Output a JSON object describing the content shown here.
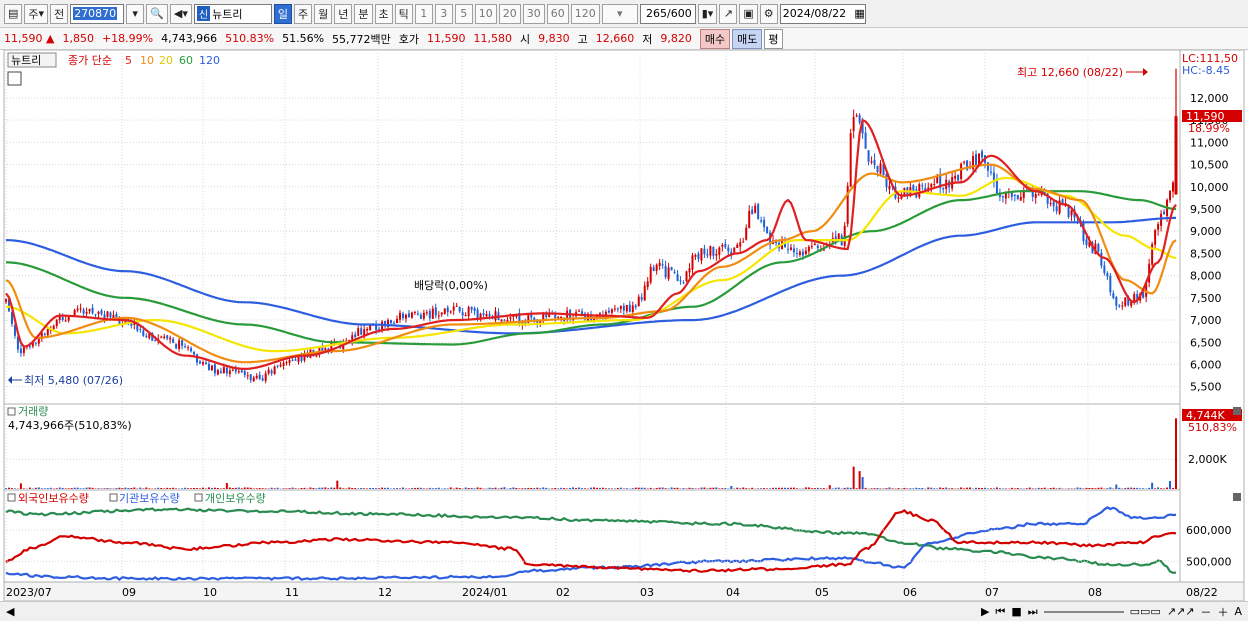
{
  "toolbar": {
    "period_type": "주",
    "prev_label": "전",
    "stock_code": "270870",
    "badge": "신",
    "stock_name": "뉴트리",
    "periods": [
      "일",
      "주",
      "월",
      "년",
      "분",
      "초",
      "틱"
    ],
    "active_period": "일",
    "intervals": [
      "1",
      "3",
      "5",
      "10",
      "20",
      "30",
      "60",
      "120"
    ],
    "count": "265",
    "count_max": "/600",
    "date": "2024/08/22"
  },
  "quote": {
    "price": "11,590",
    "change": "1,850",
    "change_pct": "+18.99%",
    "volume": "4,743,966",
    "volume_ratio": "510.83%",
    "turnover_pct": "51.56%",
    "amount": "55,772백만",
    "bid_label": "호가",
    "ask": "11,590",
    "bid": "11,580",
    "open_label": "시",
    "open": "9,830",
    "high_label": "고",
    "high": "12,660",
    "low_label": "저",
    "low": "9,820",
    "buy_label": "매수",
    "sell_label": "매도",
    "eval_label": "평"
  },
  "colors": {
    "up": "#d40000",
    "down": "#1c5fd6",
    "ma5": "#e02020",
    "ma10": "#f08c10",
    "ma20": "#f5e600",
    "ma60": "#2a9b3a",
    "ma120": "#2e5ee0",
    "foreign": "#d40000",
    "institution": "#2e5ee0",
    "individual": "#2a8b50",
    "grid": "#d8d8d8"
  },
  "chart_data": [
    {
      "type": "candlestick",
      "legend_title": "뉴트리",
      "legend": [
        "종가 단순",
        "5",
        "10",
        "20",
        "60",
        "120"
      ],
      "ylim": [
        5200,
        12900
      ],
      "y_ticks": [
        "12,000",
        "11,500",
        "11,000",
        "10,500",
        "10,000",
        "9,500",
        "9,000",
        "8,500",
        "8,000",
        "7,500",
        "7,000",
        "6,500",
        "6,000",
        "5,500"
      ],
      "y_tick_values": [
        12000,
        11500,
        11000,
        10500,
        10000,
        9500,
        9000,
        8500,
        8000,
        7500,
        7000,
        6500,
        6000,
        5500
      ],
      "x_ticks": [
        "2023/07",
        "09",
        "10",
        "11",
        "12",
        "2024/01",
        "02",
        "03",
        "04",
        "05",
        "06",
        "07",
        "08",
        "08/22"
      ],
      "right_top": "LC:111,50",
      "right_hc": "HC:-8.45",
      "current_price": "11,590",
      "current_pct": "18.99%",
      "annotation_high": "최고 12,660 (08/22)",
      "annotation_low": "최저 5,480 (07/26)",
      "annotation_div": "배당락(0,00%)",
      "ma_keypoints": {
        "ma5": [
          [
            0,
            7600
          ],
          [
            6,
            6400
          ],
          [
            18,
            7100
          ],
          [
            40,
            7000
          ],
          [
            60,
            6200
          ],
          [
            80,
            5900
          ],
          [
            100,
            6200
          ],
          [
            130,
            6800
          ],
          [
            150,
            7000
          ],
          [
            180,
            7150
          ],
          [
            200,
            7100
          ],
          [
            215,
            7050
          ],
          [
            225,
            7600
          ],
          [
            232,
            8100
          ],
          [
            245,
            8500
          ],
          [
            255,
            8800
          ],
          [
            262,
            9700
          ],
          [
            268,
            8800
          ],
          [
            282,
            8600
          ],
          [
            287,
            11500
          ],
          [
            300,
            9800
          ],
          [
            320,
            10100
          ],
          [
            330,
            10700
          ],
          [
            345,
            9900
          ],
          [
            355,
            9600
          ],
          [
            368,
            8400
          ],
          [
            378,
            7400
          ],
          [
            386,
            8300
          ],
          [
            392,
            9600
          ]
        ],
        "ma10": [
          [
            0,
            7900
          ],
          [
            10,
            6600
          ],
          [
            40,
            7050
          ],
          [
            80,
            6050
          ],
          [
            110,
            6300
          ],
          [
            150,
            6900
          ],
          [
            200,
            7050
          ],
          [
            220,
            7200
          ],
          [
            240,
            8200
          ],
          [
            260,
            8800
          ],
          [
            270,
            9000
          ],
          [
            290,
            10300
          ],
          [
            300,
            10100
          ],
          [
            330,
            10500
          ],
          [
            345,
            9950
          ],
          [
            360,
            9700
          ],
          [
            375,
            7900
          ],
          [
            384,
            7600
          ],
          [
            392,
            8800
          ]
        ],
        "ma20": [
          [
            0,
            7300
          ],
          [
            20,
            6700
          ],
          [
            50,
            7000
          ],
          [
            90,
            6300
          ],
          [
            130,
            6600
          ],
          [
            170,
            6900
          ],
          [
            210,
            7000
          ],
          [
            240,
            7900
          ],
          [
            265,
            8800
          ],
          [
            282,
            8800
          ],
          [
            300,
            9900
          ],
          [
            320,
            9800
          ],
          [
            335,
            10200
          ],
          [
            355,
            9800
          ],
          [
            375,
            8900
          ],
          [
            385,
            8600
          ],
          [
            392,
            8400
          ]
        ],
        "ma60": [
          [
            0,
            8300
          ],
          [
            40,
            7500
          ],
          [
            80,
            6900
          ],
          [
            110,
            6500
          ],
          [
            150,
            6450
          ],
          [
            175,
            6700
          ],
          [
            200,
            6900
          ],
          [
            230,
            7300
          ],
          [
            260,
            8300
          ],
          [
            290,
            9000
          ],
          [
            320,
            9700
          ],
          [
            340,
            9900
          ],
          [
            360,
            9900
          ],
          [
            380,
            9700
          ],
          [
            392,
            9500
          ]
        ],
        "ma120": [
          [
            0,
            8800
          ],
          [
            40,
            8100
          ],
          [
            80,
            7400
          ],
          [
            120,
            6900
          ],
          [
            170,
            6700
          ],
          [
            230,
            7000
          ],
          [
            280,
            8000
          ],
          [
            320,
            8900
          ],
          [
            345,
            9200
          ],
          [
            370,
            9200
          ],
          [
            392,
            9300
          ]
        ]
      },
      "candle_keypoints": [
        [
          0,
          7400
        ],
        [
          5,
          6300
        ],
        [
          10,
          6600
        ],
        [
          20,
          7100
        ],
        [
          30,
          7200
        ],
        [
          40,
          6900
        ],
        [
          55,
          6500
        ],
        [
          70,
          5900
        ],
        [
          85,
          5700
        ],
        [
          95,
          6100
        ],
        [
          110,
          6400
        ],
        [
          120,
          6800
        ],
        [
          135,
          7100
        ],
        [
          150,
          7200
        ],
        [
          165,
          7100
        ],
        [
          175,
          7000
        ],
        [
          190,
          7100
        ],
        [
          200,
          7100
        ],
        [
          210,
          7300
        ],
        [
          218,
          8200
        ],
        [
          226,
          7900
        ],
        [
          232,
          8500
        ],
        [
          245,
          8600
        ],
        [
          250,
          9500
        ],
        [
          258,
          8700
        ],
        [
          268,
          8600
        ],
        [
          280,
          8800
        ],
        [
          284,
          11600
        ],
        [
          290,
          10500
        ],
        [
          300,
          9800
        ],
        [
          315,
          10100
        ],
        [
          325,
          10600
        ],
        [
          335,
          9800
        ],
        [
          345,
          9900
        ],
        [
          355,
          9500
        ],
        [
          365,
          8600
        ],
        [
          372,
          7400
        ],
        [
          380,
          7500
        ],
        [
          386,
          9300
        ],
        [
          391,
          10000
        ],
        [
          392,
          11590
        ]
      ]
    },
    {
      "type": "bar",
      "title": "거래량",
      "summary": "4,743,966주(510,83%)",
      "y_ticks": [
        "2,000K"
      ],
      "y_tick_values": [
        2000
      ],
      "ylim": [
        0,
        5300
      ],
      "unit": "K",
      "current_label": "4,744K",
      "current_pct": "510,83%",
      "spikes": [
        [
          5,
          380
        ],
        [
          74,
          400
        ],
        [
          111,
          560
        ],
        [
          167,
          120
        ],
        [
          243,
          200
        ],
        [
          276,
          260
        ],
        [
          284,
          1500
        ],
        [
          286,
          1200
        ],
        [
          287,
          800
        ],
        [
          372,
          300
        ],
        [
          384,
          420
        ],
        [
          390,
          540
        ],
        [
          392,
          4744
        ]
      ]
    },
    {
      "type": "line",
      "series_labels": [
        "외국인보유수량",
        "기관보유수량",
        "개인보유수량"
      ],
      "y_ticks": [
        "600,000",
        "500,000"
      ],
      "y_tick_values": [
        600000,
        500000
      ],
      "ylim": [
        440000,
        680000
      ],
      "series_keypoints": {
        "foreign": [
          [
            0,
            500000
          ],
          [
            8,
            540000
          ],
          [
            20,
            580000
          ],
          [
            40,
            560000
          ],
          [
            60,
            540000
          ],
          [
            90,
            560000
          ],
          [
            110,
            570000
          ],
          [
            150,
            560000
          ],
          [
            170,
            540000
          ],
          [
            175,
            490000
          ],
          [
            200,
            480000
          ],
          [
            230,
            470000
          ],
          [
            260,
            475000
          ],
          [
            282,
            490000
          ],
          [
            288,
            540000
          ],
          [
            300,
            660000
          ],
          [
            310,
            630000
          ],
          [
            320,
            560000
          ],
          [
            345,
            560000
          ],
          [
            365,
            550000
          ],
          [
            380,
            560000
          ],
          [
            386,
            580000
          ],
          [
            392,
            590000
          ]
        ],
        "institution": [
          [
            0,
            460000
          ],
          [
            15,
            450000
          ],
          [
            40,
            445000
          ],
          [
            100,
            445000
          ],
          [
            165,
            450000
          ],
          [
            175,
            470000
          ],
          [
            200,
            480000
          ],
          [
            240,
            500000
          ],
          [
            280,
            510000
          ],
          [
            288,
            500000
          ],
          [
            300,
            480000
          ],
          [
            310,
            560000
          ],
          [
            330,
            600000
          ],
          [
            345,
            620000
          ],
          [
            360,
            620000
          ],
          [
            370,
            670000
          ],
          [
            378,
            640000
          ],
          [
            386,
            640000
          ],
          [
            392,
            650000
          ]
        ],
        "individual": [
          [
            0,
            660000
          ],
          [
            10,
            650000
          ],
          [
            50,
            665000
          ],
          [
            90,
            660000
          ],
          [
            130,
            650000
          ],
          [
            170,
            640000
          ],
          [
            200,
            630000
          ],
          [
            240,
            620000
          ],
          [
            282,
            590000
          ],
          [
            288,
            590000
          ],
          [
            300,
            560000
          ],
          [
            315,
            540000
          ],
          [
            330,
            530000
          ],
          [
            350,
            510000
          ],
          [
            370,
            490000
          ],
          [
            382,
            490000
          ],
          [
            386,
            500000
          ],
          [
            392,
            460000
          ]
        ]
      }
    }
  ],
  "statusbar": {
    "nav": [
      "▶",
      "⏮",
      "■",
      "⏭"
    ],
    "zoom_tools": [
      "－",
      "＋",
      "A"
    ]
  }
}
